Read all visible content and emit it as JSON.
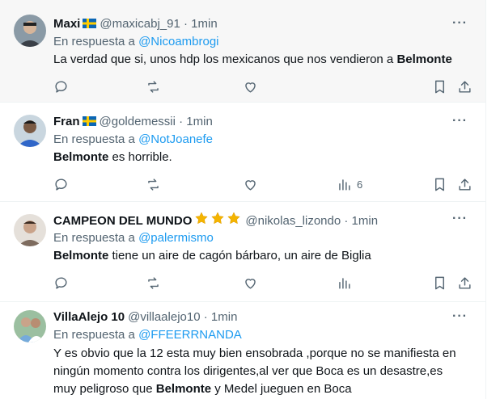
{
  "ui": {
    "reply_prefix": "En respuesta a",
    "more_glyph": "···"
  },
  "tweets": [
    {
      "name": "Maxi",
      "handle": "@maxicabj_91",
      "time": "· 1min",
      "reply_to": "@Nicoambrogi",
      "body_before": "La verdad que si, unos hdp los mexicanos que nos vendieron a ",
      "body_bold": "Belmonte",
      "body_after": "",
      "views": ""
    },
    {
      "name": "Fran",
      "handle": "@goldemessii",
      "time": "· 1min",
      "reply_to": "@NotJoanefe",
      "body_before": "",
      "body_bold": "Belmonte",
      "body_after": " es horrible.",
      "views": "6"
    },
    {
      "name": "CAMPEON DEL MUNDO",
      "handle": "@nikolas_lizondo",
      "time": "· 1min",
      "reply_to": "@palermismo",
      "body_before": "",
      "body_bold": "Belmonte",
      "body_after": " tiene un aire de cagón bárbaro, un aire de Biglia",
      "views": ""
    },
    {
      "name": "VillaAlejo 10",
      "handle": "@villaalejo10",
      "time": "· 1min",
      "reply_to": "@FFEERRNANDA",
      "body_before": "Y es obvio que la 12 esta muy bien ensobrada ,porque no se manifiesta en ningún momento contra los dirigentes,al ver que Boca es un desastre,es muy peligroso que ",
      "body_bold": "Belmonte",
      "body_after": " y Medel jueguen en Boca",
      "views": ""
    }
  ]
}
